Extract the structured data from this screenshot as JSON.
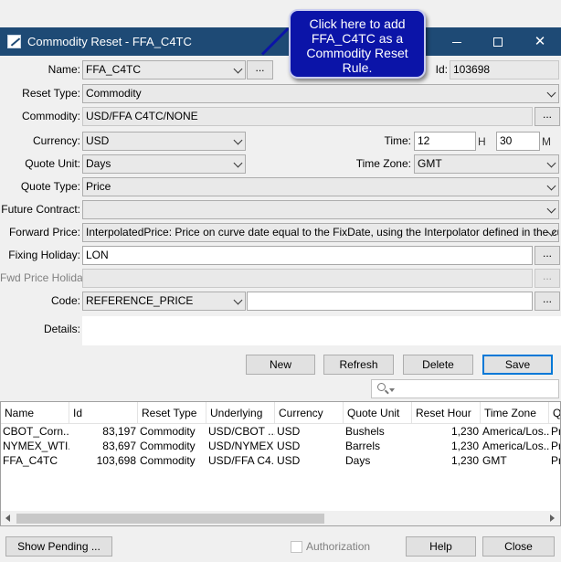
{
  "window": {
    "title": "Commodity Reset - FFA_C4TC",
    "minimize_label": "",
    "maximize_label": "",
    "close_symbol": "✕"
  },
  "callout": {
    "text": "Click here to add FFA_C4TC as a Commodity Reset Rule."
  },
  "form": {
    "name_label": "Name:",
    "name_value": "FFA_C4TC",
    "name_browse": "...",
    "id_label": "Id:",
    "id_value": "103698",
    "reset_type_label": "Reset Type:",
    "reset_type_value": "Commodity",
    "commodity_label": "Commodity:",
    "commodity_value": "USD/FFA C4TC/NONE",
    "commodity_browse": "...",
    "currency_label": "Currency:",
    "currency_value": "USD",
    "time_label": "Time:",
    "time_hour": "12",
    "time_hour_unit": "H",
    "time_minute": "30",
    "time_minute_unit": "M",
    "quote_unit_label": "Quote Unit:",
    "quote_unit_value": "Days",
    "time_zone_label": "Time Zone:",
    "time_zone_value": "GMT",
    "quote_type_label": "Quote Type:",
    "quote_type_value": "Price",
    "future_contract_label": "Future Contract:",
    "future_contract_value": "",
    "forward_price_label": "Forward Price:",
    "forward_price_value": "InterpolatedPrice: Price on curve date equal to the FixDate, using the Interpolator defined in the curve.",
    "fixing_holiday_label": "Fixing Holiday:",
    "fixing_holiday_value": "LON",
    "fixing_holiday_browse": "...",
    "fwd_price_holiday_label": "Fwd Price Holiday:",
    "fwd_price_holiday_value": "",
    "fwd_price_holiday_browse": "...",
    "code_label": "Code:",
    "code_value": "REFERENCE_PRICE",
    "code_text": "",
    "code_browse": "...",
    "details_label": "Details:"
  },
  "actions": {
    "new": "New",
    "refresh": "Refresh",
    "delete": "Delete",
    "save": "Save"
  },
  "table": {
    "columns": [
      "Name",
      "Id",
      "Reset Type",
      "Underlying",
      "Currency",
      "Quote Unit",
      "Reset Hour",
      "Time Zone",
      "Q"
    ],
    "rows": [
      [
        "CBOT_Corn...",
        "83,197",
        "Commodity",
        "USD/CBOT ...",
        "USD",
        "Bushels",
        "1,230",
        "America/Los...",
        "Pri"
      ],
      [
        "NYMEX_WTI...",
        "83,697",
        "Commodity",
        "USD/NYMEX ...",
        "USD",
        "Barrels",
        "1,230",
        "America/Los...",
        "Pri"
      ],
      [
        "FFA_C4TC",
        "103,698",
        "Commodity",
        "USD/FFA C4...",
        "USD",
        "Days",
        "1,230",
        "GMT",
        "Pri"
      ]
    ]
  },
  "footer": {
    "show_pending": "Show Pending ...",
    "authorization": "Authorization",
    "help": "Help",
    "close": "Close"
  }
}
